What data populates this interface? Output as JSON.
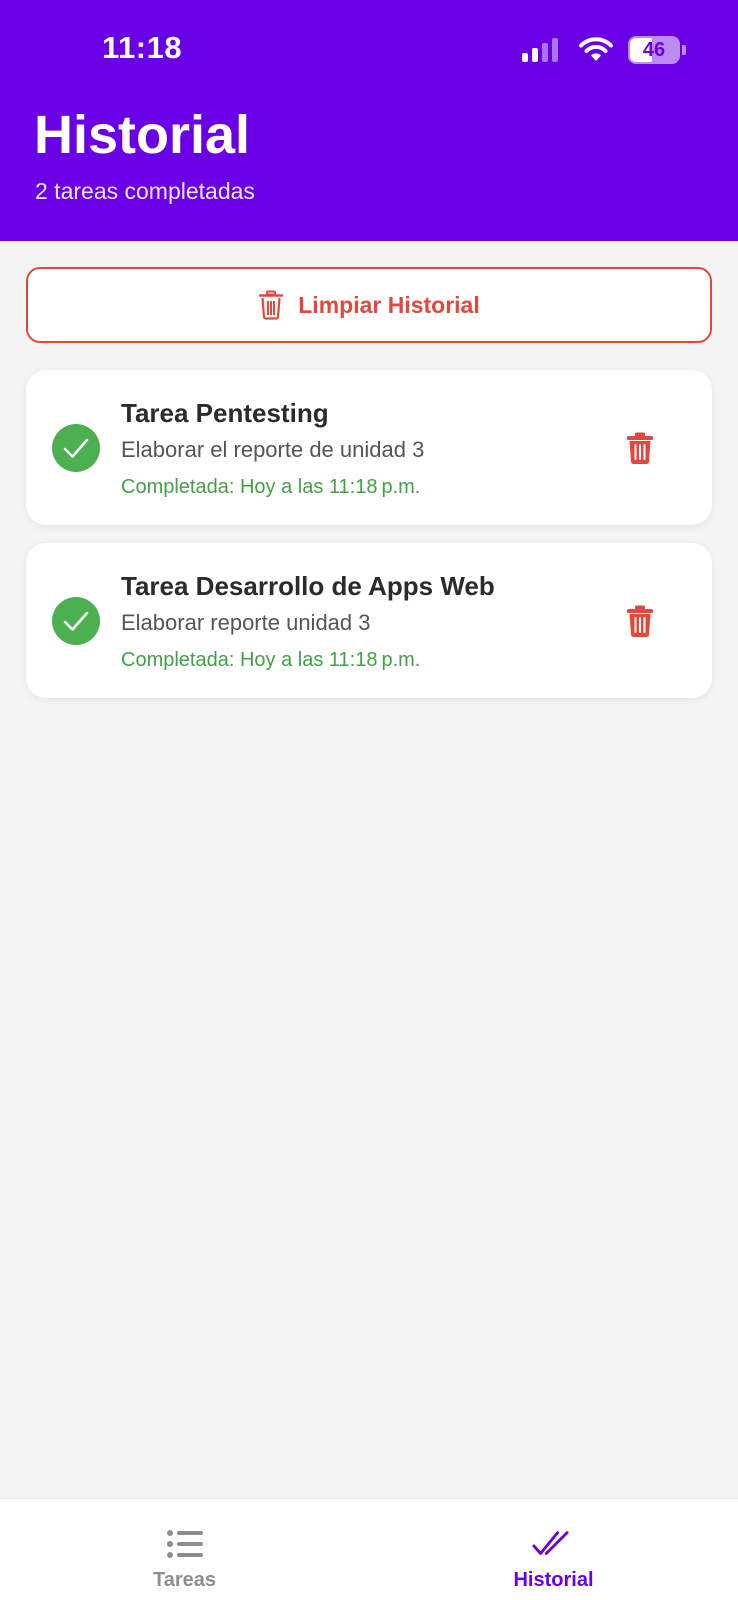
{
  "status_bar": {
    "time": "11:18",
    "battery": "46",
    "battery_fraction": 0.46
  },
  "header": {
    "title": "Historial",
    "subtitle": "2 tareas completadas"
  },
  "actions": {
    "clear_label": "Limpiar Historial"
  },
  "tasks": [
    {
      "title": "Tarea Pentesting",
      "description": "Elaborar el reporte de unidad 3",
      "completed": "Completada: Hoy a las 11:18 p.m."
    },
    {
      "title": "Tarea Desarrollo de Apps Web",
      "description": "Elaborar reporte unidad 3",
      "completed": "Completada: Hoy a las 11:18 p.m."
    }
  ],
  "nav": {
    "tareas": "Tareas",
    "historial": "Historial"
  },
  "colors": {
    "primary": "#6a00e6",
    "danger": "#e0493b",
    "success": "#4caf50",
    "background": "#f4f4f4"
  },
  "icons": {
    "status": [
      "signal-icon",
      "wifi-icon",
      "battery-icon"
    ],
    "clear": "trash-icon",
    "task_status": "check-circle-icon",
    "task_delete": "trash-icon",
    "nav_tareas": "list-icon",
    "nav_historial": "double-check-icon"
  }
}
